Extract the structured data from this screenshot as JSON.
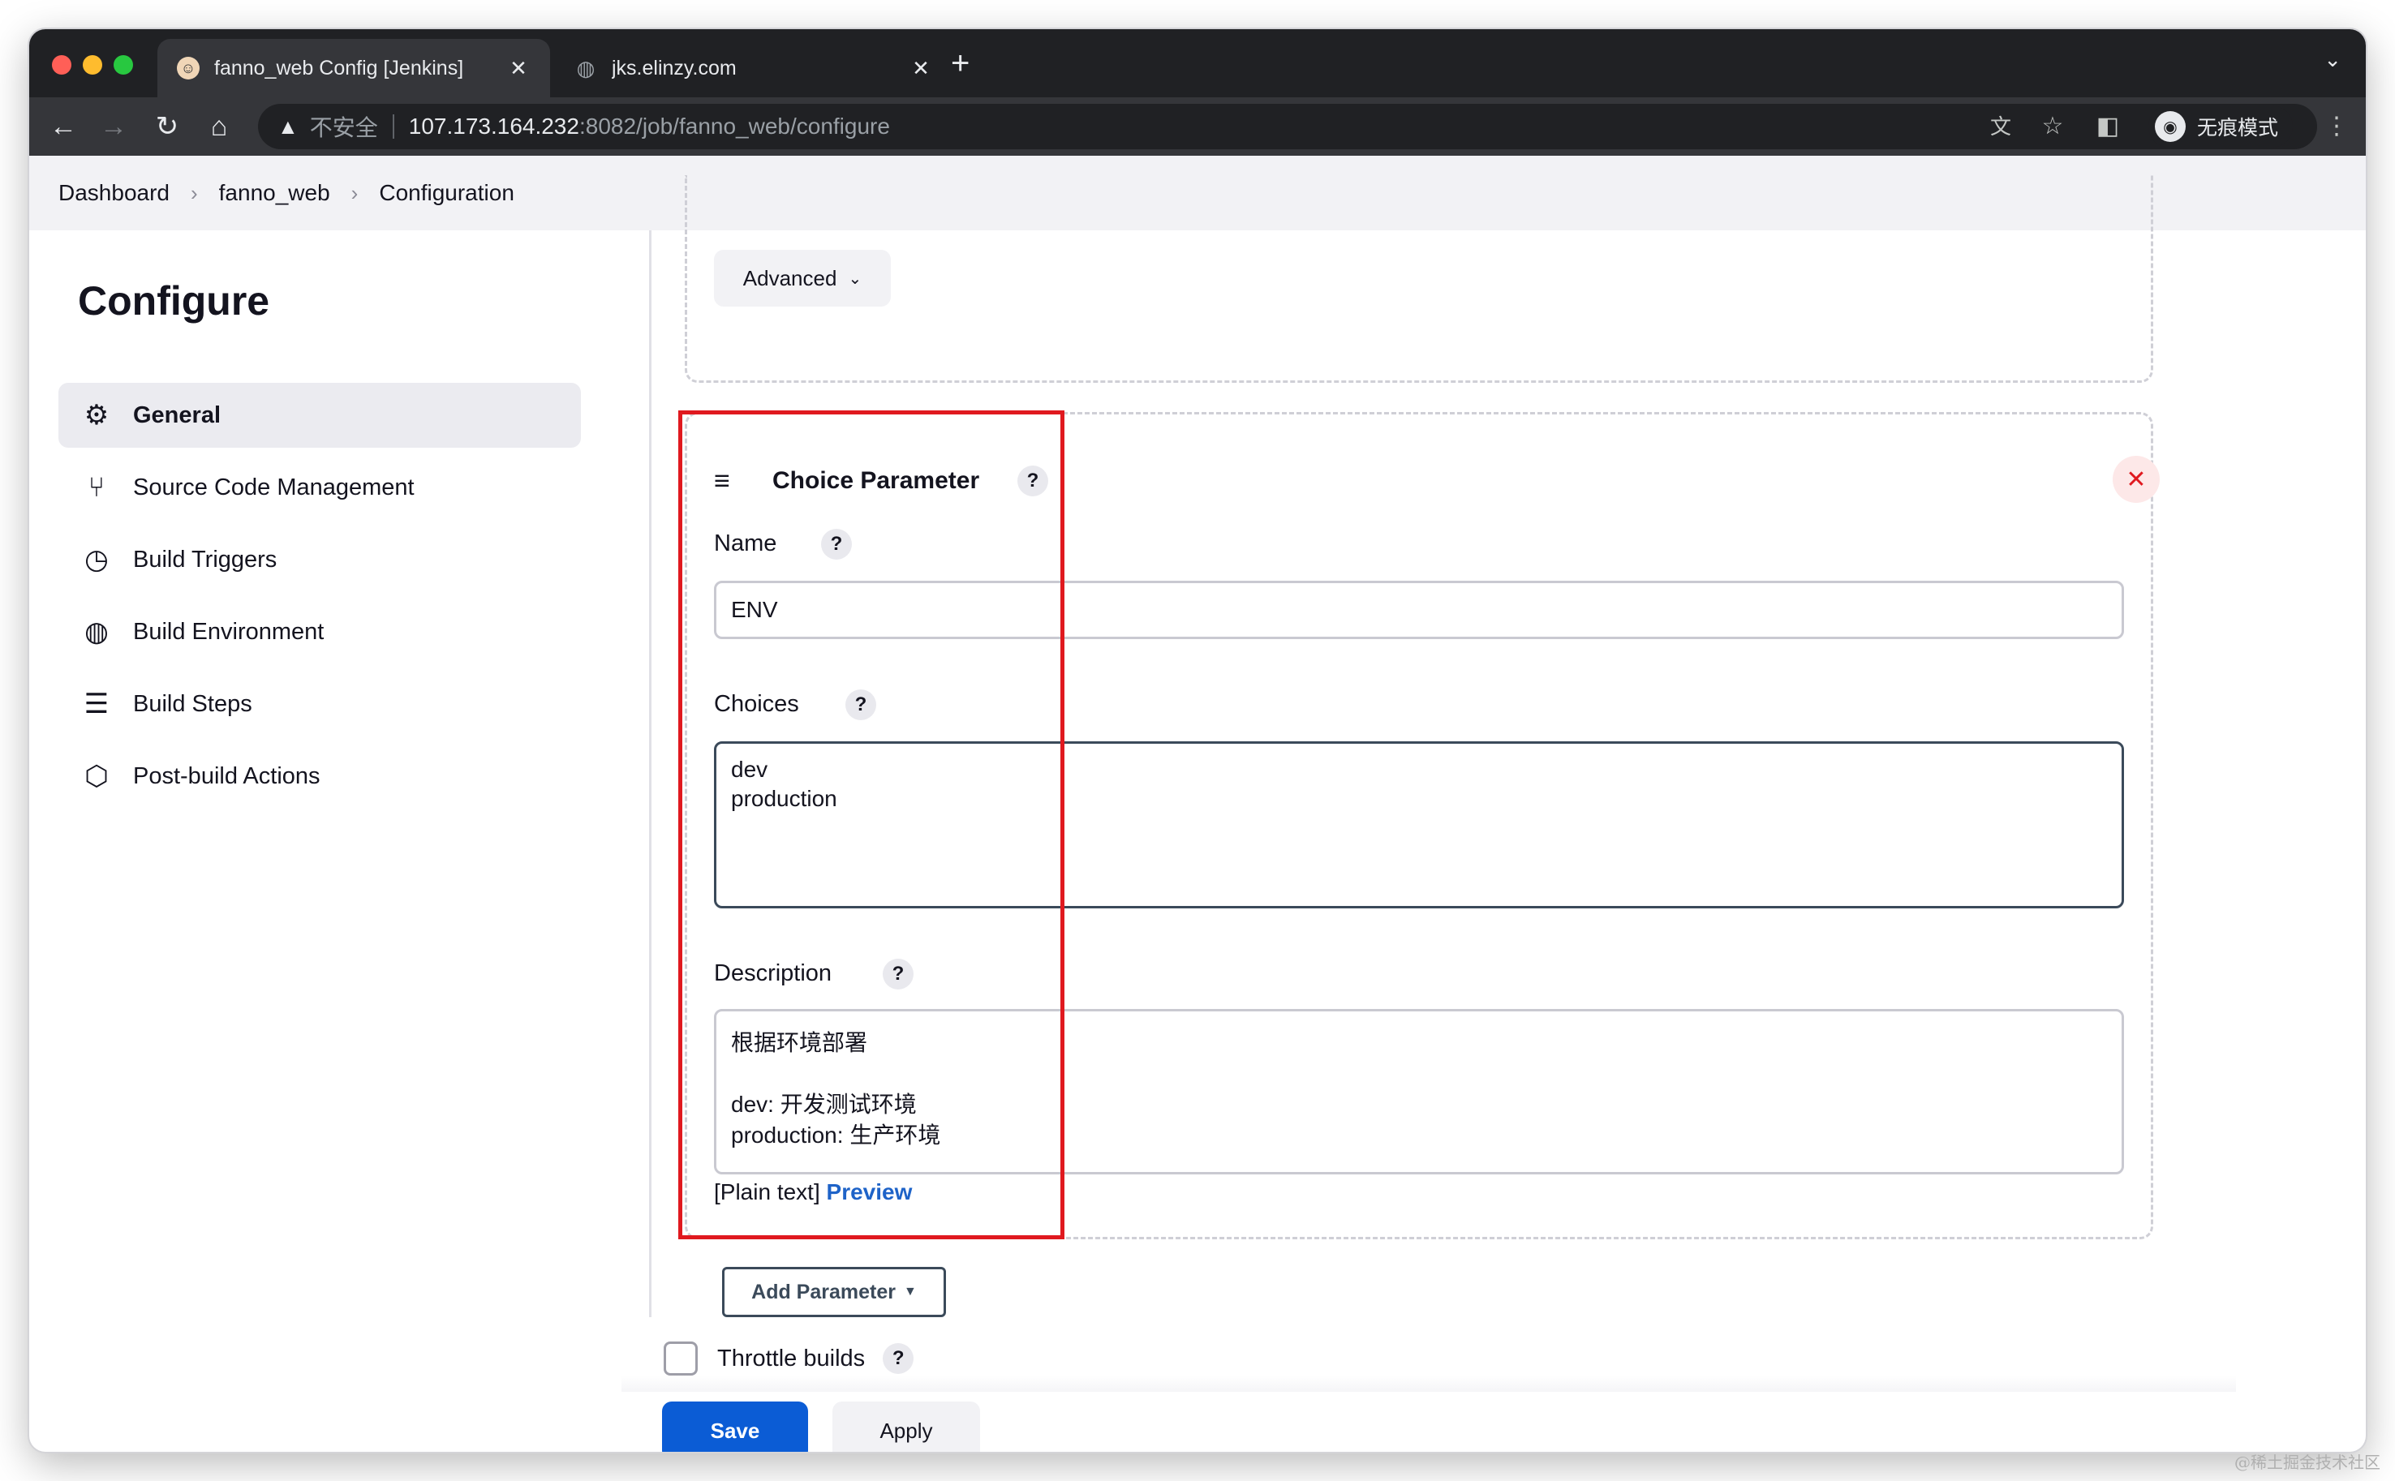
{
  "browser": {
    "tabs": [
      {
        "title": "fanno_web Config [Jenkins]",
        "active": true
      },
      {
        "title": "jks.elinzy.com",
        "active": false
      }
    ],
    "security_label": "不安全",
    "url_host": "107.173.164.232",
    "url_rest": ":8082/job/fanno_web/configure",
    "profile_label": "无痕模式"
  },
  "breadcrumb": [
    "Dashboard",
    "fanno_web",
    "Configuration"
  ],
  "sidebar": {
    "title": "Configure",
    "items": [
      {
        "label": "General",
        "icon": "gear-icon",
        "active": true
      },
      {
        "label": "Source Code Management",
        "icon": "branch-icon"
      },
      {
        "label": "Build Triggers",
        "icon": "clock-icon"
      },
      {
        "label": "Build Environment",
        "icon": "globe-icon"
      },
      {
        "label": "Build Steps",
        "icon": "list-icon"
      },
      {
        "label": "Post-build Actions",
        "icon": "package-icon"
      }
    ]
  },
  "main": {
    "advanced_label": "Advanced",
    "parameter": {
      "title": "Choice Parameter",
      "name_label": "Name",
      "name_value": "ENV",
      "choices_label": "Choices",
      "choices_value": "dev\nproduction",
      "description_label": "Description",
      "description_value": "根据环境部署\n\ndev: 开发测试环境\nproduction: 生产环境",
      "format_label": "[Plain text]",
      "preview_label": "Preview"
    },
    "add_parameter_label": "Add Parameter",
    "throttle_label": "Throttle builds",
    "save_label": "Save",
    "apply_label": "Apply"
  },
  "watermark": "@稀土掘金技术社区",
  "colors": {
    "primary": "#0b5cd5",
    "highlight_box": "#e0191f",
    "link": "#1e63c8"
  }
}
